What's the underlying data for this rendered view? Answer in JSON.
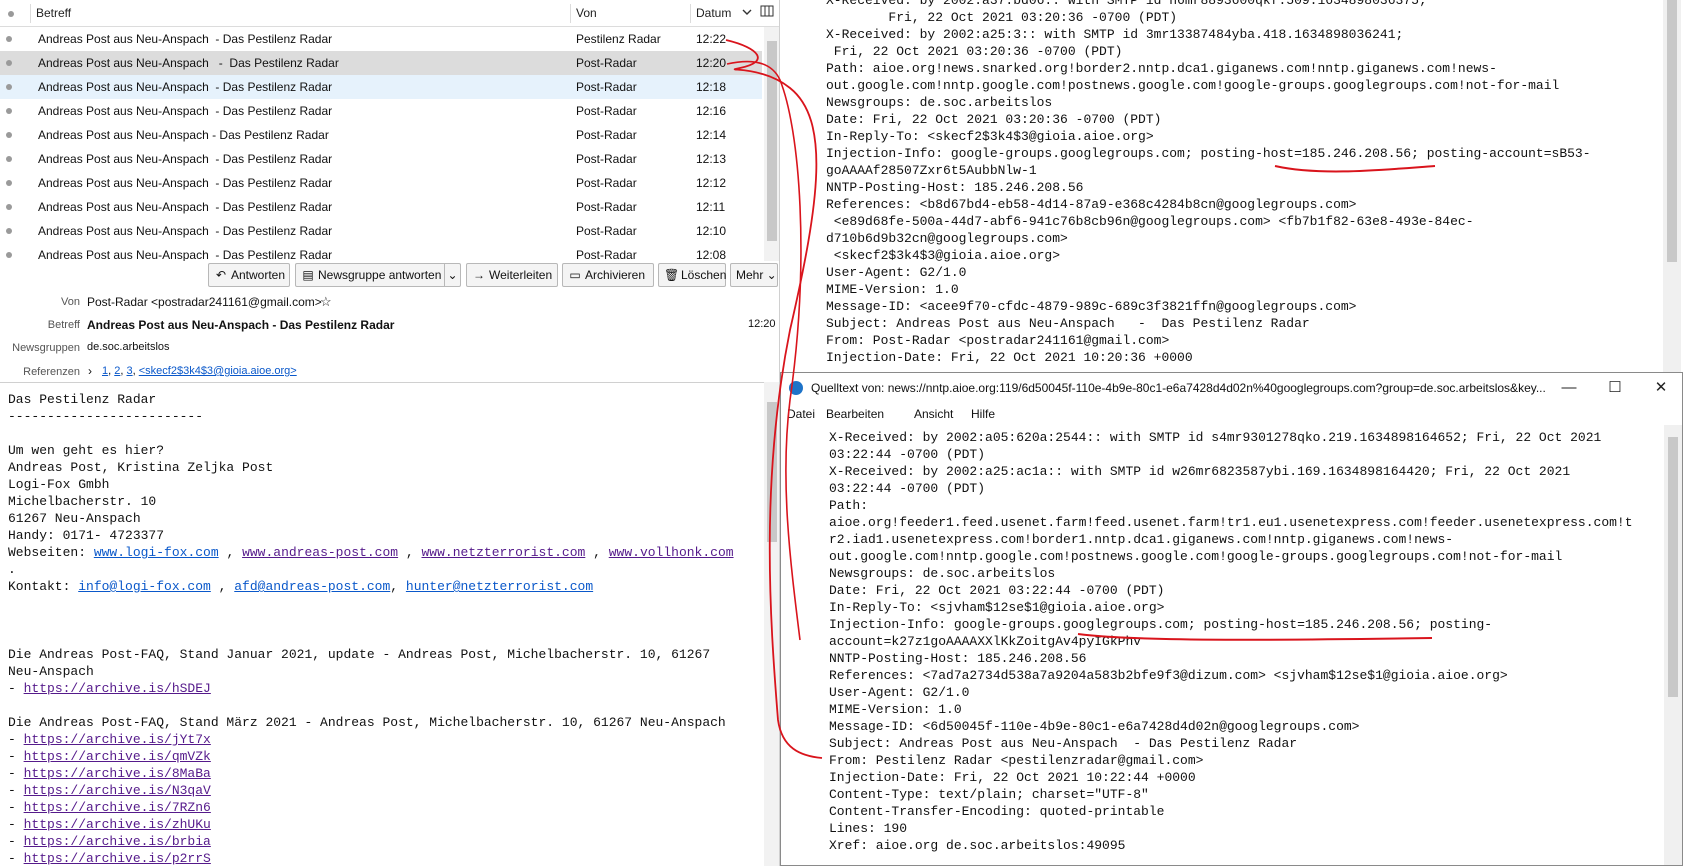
{
  "list": {
    "columns": {
      "subject": "Betreff",
      "from": "Von",
      "date": "Datum"
    },
    "rows": [
      {
        "subject": "Andreas Post aus Neu-Anspach  - Das Pestilenz Radar",
        "from": "Pestilenz Radar",
        "date": "12:22"
      },
      {
        "subject": "Andreas Post aus Neu-Anspach   -  Das Pestilenz Radar",
        "from": "Post-Radar",
        "date": "12:20"
      },
      {
        "subject": "Andreas Post aus Neu-Anspach  - Das Pestilenz Radar",
        "from": "Post-Radar",
        "date": "12:18"
      },
      {
        "subject": "Andreas Post aus Neu-Anspach  - Das Pestilenz Radar",
        "from": "Post-Radar",
        "date": "12:16"
      },
      {
        "subject": "Andreas Post aus Neu-Anspach - Das Pestilenz Radar",
        "from": "Post-Radar",
        "date": "12:14"
      },
      {
        "subject": "Andreas Post aus Neu-Anspach  - Das Pestilenz Radar",
        "from": "Post-Radar",
        "date": "12:13"
      },
      {
        "subject": "Andreas Post aus Neu-Anspach  - Das Pestilenz Radar",
        "from": "Post-Radar",
        "date": "12:12"
      },
      {
        "subject": "Andreas Post aus Neu-Anspach  - Das Pestilenz Radar",
        "from": "Post-Radar",
        "date": "12:11"
      },
      {
        "subject": "Andreas Post aus Neu-Anspach  - Das Pestilenz Radar",
        "from": "Post-Radar",
        "date": "12:10"
      },
      {
        "subject": "Andreas Post aus Neu-Anspach  - Das Pestilenz Radar",
        "from": "Post-Radar",
        "date": "12:08"
      }
    ]
  },
  "toolbar": {
    "reply": "Antworten",
    "reply_group": "Newsgruppe antworten",
    "forward": "Weiterleiten",
    "archive": "Archivieren",
    "delete": "Löschen",
    "more": "Mehr"
  },
  "header": {
    "from_label": "Von",
    "from_value": "Post-Radar <postradar241161@gmail.com>",
    "subject_label": "Betreff",
    "subject_value": "Andreas Post aus Neu-Anspach - Das Pestilenz Radar",
    "time": "12:20",
    "groups_label": "Newsgruppen",
    "groups_value": "de.soc.arbeitslos",
    "refs_label": "Referenzen",
    "refs": [
      "1",
      "2",
      "3"
    ],
    "refs_last": "<skecf2$3k4$3@gioia.aioe.org>"
  },
  "body": {
    "title": "Das Pestilenz Radar",
    "underline": "-------------------------",
    "q": "Um wen geht es hier?",
    "names": "Andreas Post, Kristina Zeljka Post",
    "company": "Logi-Fox Gmbh",
    "street": "Michelbacherstr. 10",
    "city": "61267 Neu-Anspach",
    "phone": "Handy: 0171- 4723377",
    "web_label": "Webseiten: ",
    "web": [
      "www.logi-fox.com",
      "www.andreas-post.com",
      "www.netzterrorist.com",
      "www.vollhonk.com"
    ],
    "contact_label": "Kontakt: ",
    "contact": [
      "info@logi-fox.com",
      "afd@andreas-post.com",
      "hunter@netzterrorist.com"
    ],
    "faq1a": "Die Andreas Post-FAQ, Stand Januar 2021, update - Andreas Post, Michelbacherstr. 10, 61267",
    "faq1b": "Neu-Anspach",
    "faq1_link": "https://archive.is/hSDEJ",
    "faq2": "Die Andreas Post-FAQ, Stand März 2021 - Andreas Post, Michelbacherstr. 10, 61267 Neu-Anspach",
    "faq2_links": [
      "https://archive.is/jYt7x",
      "https://archive.is/qmVZk",
      "https://archive.is/8MaBa",
      "https://archive.is/N3qaV",
      "https://archive.is/7RZn6",
      "https://archive.is/zhUKu",
      "https://archive.is/brbia",
      "https://archive.is/p2rrS"
    ]
  },
  "source_top": {
    "lines": [
      "X-Received: by 2002:a37:bd06:: with SMTP id h6mr8893600qkf.509.1634898036375;",
      "        Fri, 22 Oct 2021 03:20:36 -0700 (PDT)",
      "X-Received: by 2002:a25:3:: with SMTP id 3mr13387484yba.418.1634898036241;",
      " Fri, 22 Oct 2021 03:20:36 -0700 (PDT)",
      "Path: aioe.org!news.snarked.org!border2.nntp.dca1.giganews.com!nntp.giganews.com!news-",
      "out.google.com!nntp.google.com!postnews.google.com!google-groups.googlegroups.com!not-for-mail",
      "Newsgroups: de.soc.arbeitslos",
      "Date: Fri, 22 Oct 2021 03:20:36 -0700 (PDT)",
      "In-Reply-To: <skecf2$3k4$3@gioia.aioe.org>",
      "Injection-Info: google-groups.googlegroups.com; posting-host=185.246.208.56; posting-account=sB53-",
      "goAAAAf28507Zxr6t5AubbNlw-1",
      "NNTP-Posting-Host: 185.246.208.56",
      "References: <b8d67bd4-eb58-4d14-87a9-e368c4284b8cn@googlegroups.com>",
      " <e89d68fe-500a-44d7-abf6-941c76b8cb96n@googlegroups.com> <fb7b1f82-63e8-493e-84ec-",
      "d710b6d9b32cn@googlegroups.com>",
      " <skecf2$3k4$3@gioia.aioe.org>",
      "User-Agent: G2/1.0",
      "MIME-Version: 1.0",
      "Message-ID: <acee9f70-cfdc-4879-989c-689c3f3821ffn@googlegroups.com>",
      "Subject: Andreas Post aus Neu-Anspach   -  Das Pestilenz Radar",
      "From: Post-Radar <postradar241161@gmail.com>",
      "Injection-Date: Fri, 22 Oct 2021 10:20:36 +0000"
    ]
  },
  "window": {
    "title": "Quelltext von: news://nntp.aioe.org:119/6d50045f-110e-4b9e-80c1-e6a7428d4d02n%40googlegroups.com?group=de.soc.arbeitslos&key...",
    "minimize": "—",
    "maximize": "☐",
    "close": "✕",
    "menu": {
      "file": "Datei",
      "edit": "Bearbeiten",
      "view": "Ansicht",
      "help": "Hilfe"
    },
    "lines": [
      "X-Received: by 2002:a05:620a:2544:: with SMTP id s4mr9301278qko.219.1634898164652; Fri, 22 Oct 2021",
      "03:22:44 -0700 (PDT)",
      "X-Received: by 2002:a25:ac1a:: with SMTP id w26mr6823587ybi.169.1634898164420; Fri, 22 Oct 2021",
      "03:22:44 -0700 (PDT)",
      "Path:",
      "aioe.org!feeder1.feed.usenet.farm!feed.usenet.farm!tr1.eu1.usenetexpress.com!feeder.usenetexpress.com!t",
      "r2.iad1.usenetexpress.com!border1.nntp.dca1.giganews.com!nntp.giganews.com!news-",
      "out.google.com!nntp.google.com!postnews.google.com!google-groups.googlegroups.com!not-for-mail",
      "Newsgroups: de.soc.arbeitslos",
      "Date: Fri, 22 Oct 2021 03:22:44 -0700 (PDT)",
      "In-Reply-To: <sjvham$12se$1@gioia.aioe.org>",
      "Injection-Info: google-groups.googlegroups.com; posting-host=185.246.208.56; posting-",
      "account=k27z1goAAAAXXlKkZoitgAv4pyIGkPhv",
      "NNTP-Posting-Host: 185.246.208.56",
      "References: <7ad7a2734d538a7a9204a583b2bfe9f3@dizum.com> <sjvham$12se$1@gioia.aioe.org>",
      "User-Agent: G2/1.0",
      "MIME-Version: 1.0",
      "Message-ID: <6d50045f-110e-4b9e-80c1-e6a7428d4d02n@googlegroups.com>",
      "Subject: Andreas Post aus Neu-Anspach  - Das Pestilenz Radar",
      "From: Pestilenz Radar <pestilenzradar@gmail.com>",
      "Injection-Date: Fri, 22 Oct 2021 10:22:44 +0000",
      "Content-Type: text/plain; charset=\"UTF-8\"",
      "Content-Transfer-Encoding: quoted-printable",
      "Lines: 190",
      "Xref: aioe.org de.soc.arbeitslos:49095"
    ]
  },
  "colors": {
    "link": "#0a58ca",
    "visited": "#551a8b",
    "annotation": "#d9141c",
    "selected_row": "#dcdcdc",
    "hover_row": "#e6f2fc"
  }
}
